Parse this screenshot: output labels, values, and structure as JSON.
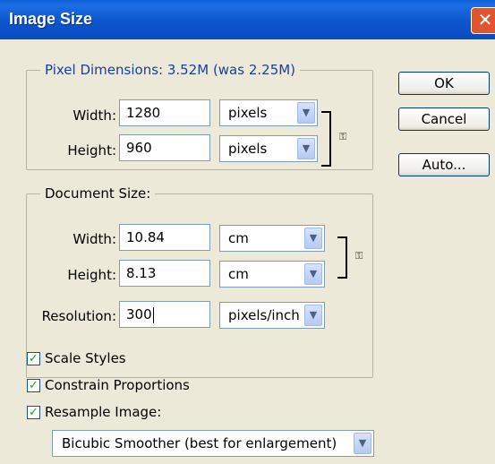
{
  "window": {
    "title": "Image Size",
    "close_glyph": "✕"
  },
  "pixel_dimensions": {
    "legend": "Pixel Dimensions:  3.52M (was 2.25M)",
    "width_label": "Width:",
    "width_value": "1280",
    "width_unit": "pixels",
    "height_label": "Height:",
    "height_value": "960",
    "height_unit": "pixels"
  },
  "document_size": {
    "legend": "Document Size:",
    "width_label": "Width:",
    "width_value": "10.84",
    "width_unit": "cm",
    "height_label": "Height:",
    "height_value": "8.13",
    "height_unit": "cm",
    "resolution_label": "Resolution:",
    "resolution_value": "300",
    "resolution_unit": "pixels/inch"
  },
  "buttons": {
    "ok": "OK",
    "cancel": "Cancel",
    "auto": "Auto..."
  },
  "options": {
    "scale_styles": {
      "label": "Scale Styles",
      "checked": true
    },
    "constrain_proportions": {
      "label": "Constrain Proportions",
      "checked": true
    },
    "resample_image": {
      "label": "Resample Image:",
      "checked": true
    },
    "resample_method": "Bicubic Smoother (best for enlargement)"
  },
  "icons": {
    "dropdown": "chevron-down-icon",
    "link": "chain-link-icon",
    "check": "checkmark-icon"
  },
  "colors": {
    "titlebar": "#0a55cc",
    "dialog_bg": "#ece9d8",
    "legend_text": "#1a3e9e",
    "checkmark": "#21a121",
    "close_button": "#e0542f"
  }
}
